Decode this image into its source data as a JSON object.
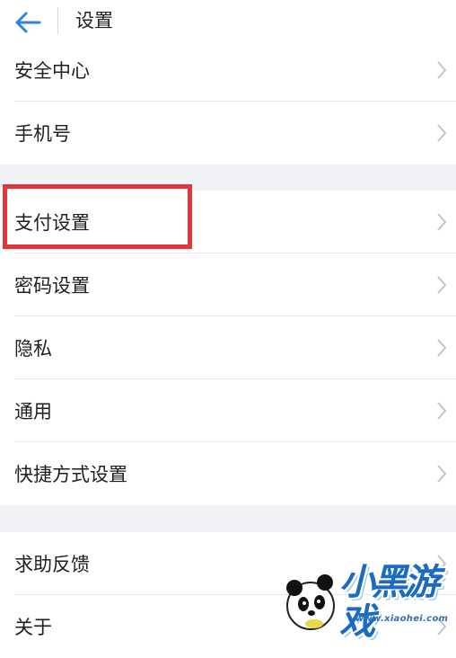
{
  "header": {
    "title": "设置"
  },
  "sections": [
    {
      "items": [
        {
          "label": "安全中心"
        },
        {
          "label": "手机号"
        }
      ]
    },
    {
      "items": [
        {
          "label": "支付设置"
        },
        {
          "label": "密码设置"
        },
        {
          "label": "隐私"
        },
        {
          "label": "通用"
        },
        {
          "label": "快捷方式设置"
        }
      ]
    },
    {
      "items": [
        {
          "label": "求助反馈"
        },
        {
          "label": "关于"
        }
      ]
    }
  ],
  "highlighted_item": "支付设置",
  "watermark": {
    "logo_text": "小黑游戏",
    "site": "www.xiaohei.com"
  },
  "colors": {
    "back_arrow": "#2b86e0",
    "highlight_border": "#e2363b",
    "page_background": "#f1f2f5"
  }
}
